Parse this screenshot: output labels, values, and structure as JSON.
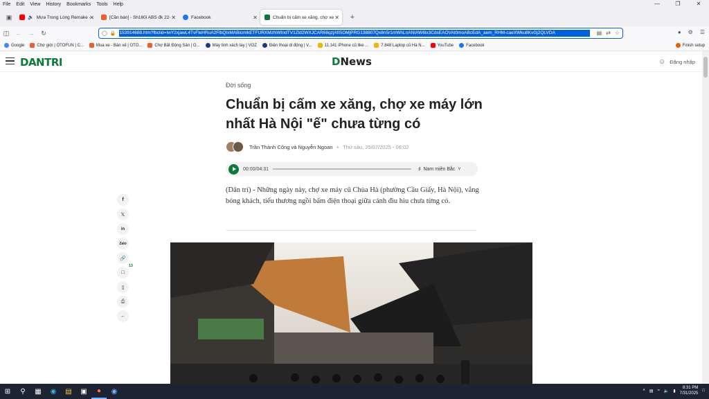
{
  "menu": [
    "File",
    "Edit",
    "View",
    "History",
    "Bookmarks",
    "Tools",
    "Help"
  ],
  "tabs": [
    {
      "label": "Mưa Trong Lòng Remake -",
      "color": "#ff0000",
      "active": false
    },
    {
      "label": "[Cần bán] - Sh160i ABS đk 22-1",
      "color": "#e8622a",
      "active": false
    },
    {
      "label": "Facebook",
      "color": "#1877f2",
      "active": false
    },
    {
      "label": "Chuẩn bị cấm xe xăng, chợ xe m",
      "color": "#0b7a3b",
      "active": true
    }
  ],
  "url": "153914688.htm?fbclid=IwY2xjawL4TvFleHRuA2FlbQIxMABicmlkETFURXMzNWtndTV1Zld2WXJCAR68qzjAfiSOMjPRG138807Qx8n5r1mWhLnANIAW6lx3CdsEAOVAt0moABcEdA_aem_RHM-caeXWku8KvGj2QLVDA",
  "bookmarks": [
    {
      "label": "Google",
      "color": "#4285f4"
    },
    {
      "label": "Chợ giời | OTOFUN | C...",
      "color": "#e8622a"
    },
    {
      "label": "Mua xe - Bán xế | OTO...",
      "color": "#e8622a"
    },
    {
      "label": "Chợ Bất Động Sản | O...",
      "color": "#e8622a"
    },
    {
      "label": "Máy tính xách tay | VOZ",
      "color": "#1a3c7a"
    },
    {
      "label": "Điện thoại di động | V...",
      "color": "#1a3c7a"
    },
    {
      "label": "11.141 iPhone cũ like ...",
      "color": "#f5b400"
    },
    {
      "label": "7.848 Laptop cũ Hà N...",
      "color": "#f5b400"
    },
    {
      "label": "YouTube",
      "color": "#ff0000"
    },
    {
      "label": "Facebook",
      "color": "#1877f2"
    }
  ],
  "finish_setup": "Finish setup",
  "site": {
    "logo_left": "DANTRI",
    "logo_center_d": "D",
    "logo_center_news": "News",
    "login": "Đăng nhập"
  },
  "article": {
    "category": "Đời sống",
    "title": "Chuẩn bị cấm xe xăng, chợ xe máy lớn nhất Hà Nội \"ế\" chưa từng có",
    "authors": "Trần Thành Công và Nguyễn Ngoan",
    "time": "Thứ sáu, 25/07/2025 - 06:02",
    "audio_time": "00:00/04:31",
    "audio_voice": "Nam miền Bắc",
    "sapo": "(Dân trí) - Những ngày này, chợ xe máy cũ Chùa Hà (phường Cầu Giấy, Hà Nội), vắng bóng khách, tiểu thương ngồi bấm điện thoại giữa cảnh đìu hiu chưa từng có."
  },
  "share": {
    "zalo": "Zalo",
    "comments": "13"
  },
  "clock": {
    "time": "8:31 PM",
    "date": "7/31/2025"
  }
}
